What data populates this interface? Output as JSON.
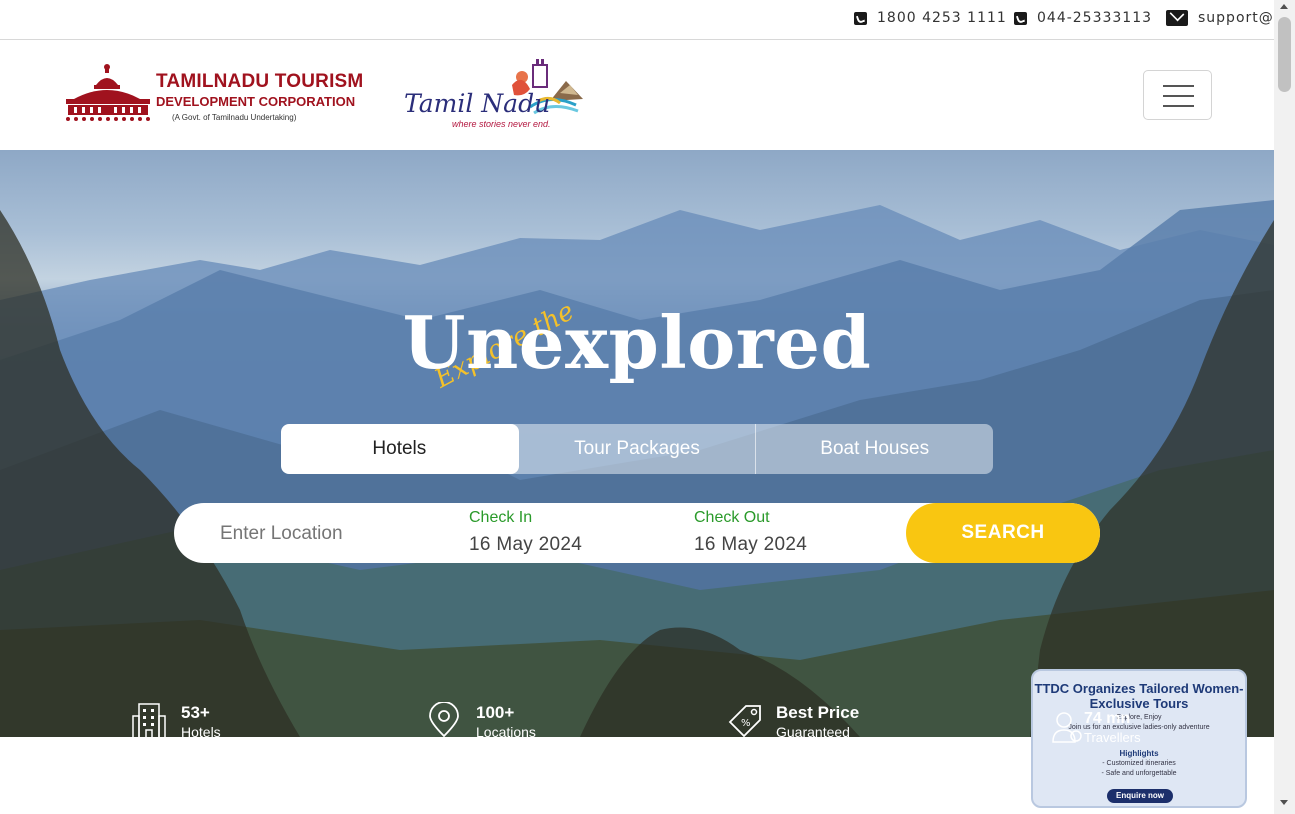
{
  "topbar": {
    "phone1": "1800 4253 1111",
    "phone2": "044-25333113",
    "email": "support@",
    "phone_icon": "phone-square-icon",
    "email_icon": "envelope-icon"
  },
  "header": {
    "ttdc_line1": "TAMILNADU TOURISM",
    "ttdc_line2": "DEVELOPMENT CORPORATION",
    "ttdc_line3": "(A Govt. of Tamilnadu Undertaking)",
    "tn_logo_text": "Tamil Nadu",
    "tn_logo_tagline": "where stories never end.",
    "menu_icon": "hamburger-menu-icon"
  },
  "hero": {
    "script_text": "Explore the",
    "headline": "Unexplored",
    "tabs": [
      {
        "label": "Hotels",
        "active": true
      },
      {
        "label": "Tour Packages",
        "active": false
      },
      {
        "label": "Boat Houses",
        "active": false
      }
    ],
    "search": {
      "location_placeholder": "Enter Location",
      "checkin_label": "Check In",
      "checkin_value": "16 May 2024",
      "checkout_label": "Check Out",
      "checkout_value": "16 May 2024",
      "button_label": "SEARCH"
    },
    "stats": [
      {
        "number": "53+",
        "label": "Hotels",
        "icon": "building-icon"
      },
      {
        "number": "100+",
        "label": "Locations",
        "icon": "map-pin-icon"
      },
      {
        "number": "Best Price",
        "label": "Guaranteed",
        "icon": "price-tag-icon"
      },
      {
        "number": "74 mn",
        "label": "Travellers",
        "icon": "users-icon"
      }
    ]
  },
  "popup": {
    "title": "TTDC Organizes Tailored Women-Exclusive Tours",
    "subtitle": "Explore, Enjoy",
    "subtitle2": "Join us for an exclusive ladies-only adventure",
    "highlights_label": "Highlights",
    "highlight_items": [
      "- Customized itineraries",
      "- Safe and unforgettable"
    ],
    "button_label": "Enquire now"
  },
  "colors": {
    "brand_red": "#a0121e",
    "search_button": "#f9c611",
    "label_green": "#2a9a2a",
    "script_yellow": "#f4c12a"
  }
}
